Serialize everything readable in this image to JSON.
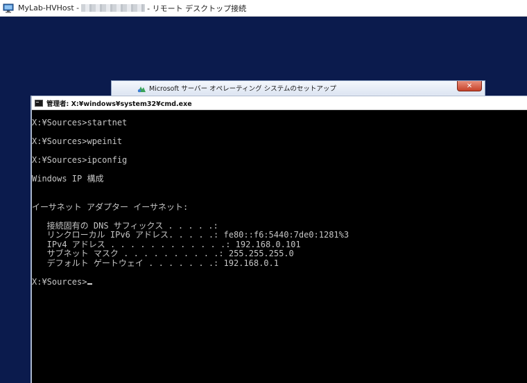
{
  "rdp_window": {
    "title_prefix": "MyLab-HVHost -",
    "title_suffix": "- リモート デスクトップ接続"
  },
  "setup_window": {
    "title": "Microsoft サーバー オペレーティング システムのセットアップ",
    "close_glyph": "✕"
  },
  "cmd_window": {
    "title": "管理者: X:¥windows¥system32¥cmd.exe",
    "lines": {
      "l1": "X:¥Sources>startnet",
      "l2": "X:¥Sources>wpeinit",
      "l3": "X:¥Sources>ipconfig",
      "l4": "Windows IP 構成",
      "l5": "イーサネット アダプター イーサネット:",
      "l6": "   接続固有の DNS サフィックス . . . . .:",
      "l7": "   リンクローカル IPv6 アドレス. . . . .: fe80::f6:5440:7de0:1281%3",
      "l8": "   IPv4 アドレス . . . . . . . . . . . .: 192.168.0.101",
      "l9": "   サブネット マスク . . . . . . . . . .: 255.255.255.0",
      "l10": "   デフォルト ゲートウェイ . . . . . . .: 192.168.0.1",
      "prompt": "X:¥Sources>"
    }
  },
  "colors": {
    "desktop_bg": "#0b1b4d",
    "console_bg": "#000000",
    "console_text": "#c6c6c6"
  },
  "icons": {
    "rdp": "remote-desktop-icon",
    "setup": "setup-icon",
    "cmd": "cmd-icon",
    "close": "close-icon"
  }
}
